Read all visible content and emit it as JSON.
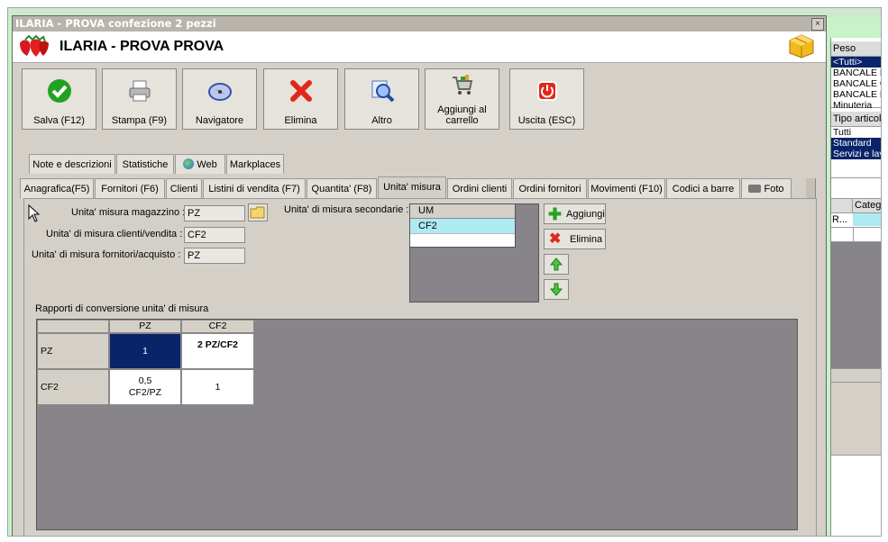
{
  "window": {
    "title": "ILARIA - PROVA confezione 2 pezzi",
    "header_title": "ILARIA - PROVA PROVA",
    "close_glyph": "×"
  },
  "toolbar": {
    "save": "Salva (F12)",
    "print": "Stampa (F9)",
    "navigator": "Navigatore",
    "delete": "Elimina",
    "other": "Altro",
    "add_cart": "Aggiungi al carrello",
    "exit": "Uscita (ESC)"
  },
  "tabs_top": [
    "Note e descrizioni",
    "Statistiche",
    "Web",
    "Markplaces"
  ],
  "tabs_main": [
    "Anagrafica(F5)",
    "Fornitori (F6)",
    "Clienti",
    "Listini di vendita (F7)",
    "Quantita' (F8)",
    "Unita' misura",
    "Ordini clienti",
    "Ordini fornitori",
    "Movimenti (F10)",
    "Codici a barre",
    "Foto"
  ],
  "active_tab": "Unita' misura",
  "form": {
    "um_magazzino_label": "Unita' misura magazzino :",
    "um_magazzino_value": "PZ",
    "um_clienti_label": "Unita' di misura clienti/vendita :",
    "um_clienti_value": "CF2",
    "um_fornitori_label": "Unita' di misura fornitori/acquisto :",
    "um_fornitori_value": "PZ",
    "um_secondarie_label": "Unita' di misura secondarie :",
    "secondary_header": "UM",
    "secondary_items": [
      "CF2"
    ],
    "add_label": "Aggiungi",
    "delete_label": "Elimina"
  },
  "conversion": {
    "title": "Rapporti di conversione unita' di misura",
    "columns": [
      "PZ",
      "CF2"
    ],
    "rows": [
      {
        "label": "PZ",
        "cells": [
          "1",
          "2 PZ/CF2"
        ]
      },
      {
        "label": "CF2",
        "cells": [
          "0,5 CF2/PZ",
          "1"
        ]
      }
    ]
  },
  "right_panel": {
    "peso_header": "Peso",
    "peso_items": [
      "<Tutti>",
      "BANCALE P",
      "BANCALE G",
      "BANCALE E",
      "Minuteria"
    ],
    "tipo_header": "Tipo articolo",
    "tipo_items": [
      "Tutti",
      "Standard",
      "Servizi e lav"
    ],
    "categ_header": "Categ",
    "categ_row": "R..."
  },
  "colors": {
    "selection": "#0a246a",
    "window_bg": "#c8f2c8",
    "dialog_bg": "#d4d0c8"
  }
}
